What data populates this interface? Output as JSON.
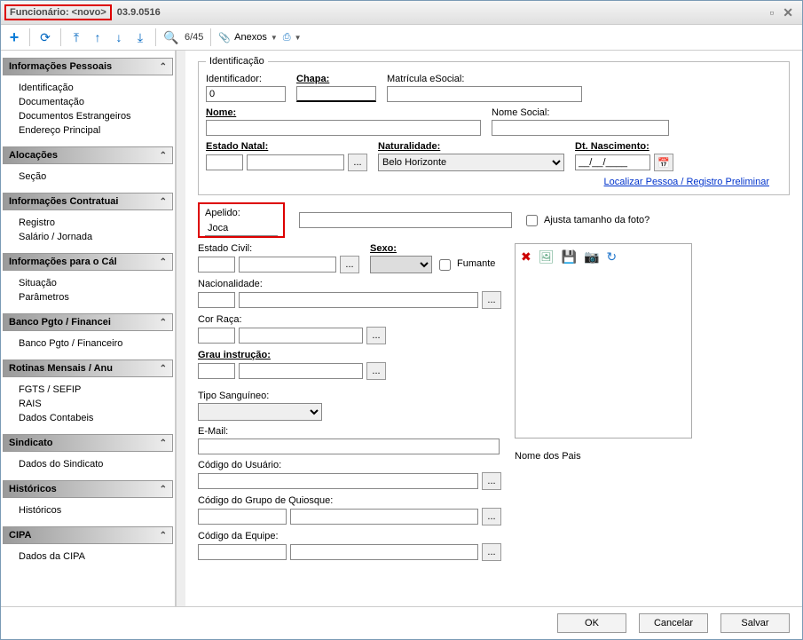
{
  "window": {
    "title_hl": "Funcionário: <novo>",
    "title_rest": "03.9.0516"
  },
  "toolbar": {
    "counter": "6/45",
    "anexos": "Anexos"
  },
  "sidebar": [
    {
      "title": "Informações Pessoais",
      "items": [
        "Identificação",
        "Documentação",
        "Documentos Estrangeiros",
        "Endereço Principal"
      ]
    },
    {
      "title": "Alocações",
      "items": [
        "Seção"
      ]
    },
    {
      "title": "Informações Contratuai",
      "items": [
        "Registro",
        "Salário / Jornada"
      ]
    },
    {
      "title": "Informações para o Cál",
      "items": [
        "Situação",
        "Parâmetros"
      ]
    },
    {
      "title": "Banco Pgto / Financei",
      "items": [
        "Banco Pgto / Financeiro"
      ]
    },
    {
      "title": "Rotinas Mensais / Anu",
      "items": [
        "FGTS / SEFIP",
        "RAIS",
        "Dados Contabeis"
      ]
    },
    {
      "title": "Sindicato",
      "items": [
        "Dados do Sindicato"
      ]
    },
    {
      "title": "Históricos",
      "items": [
        "Históricos"
      ]
    },
    {
      "title": "CIPA",
      "items": [
        "Dados da CIPA"
      ]
    }
  ],
  "form": {
    "legend": "Identificação",
    "identificador": {
      "label": "Identificador:",
      "value": "0"
    },
    "chapa": {
      "label": "Chapa:"
    },
    "matricula": {
      "label": "Matrícula eSocial:"
    },
    "nome": {
      "label": "Nome:"
    },
    "nome_social": {
      "label": "Nome Social:"
    },
    "estado_natal": {
      "label": "Estado Natal:"
    },
    "naturalidade": {
      "label": "Naturalidade:",
      "value": "Belo Horizonte"
    },
    "dt_nasc": {
      "label": "Dt. Nascimento:",
      "value": "__/__/____"
    },
    "localizar_link": "Localizar Pessoa / Registro Preliminar",
    "apelido": {
      "label": "Apelido:",
      "value": "Joca"
    },
    "ajusta_foto": "Ajusta tamanho da foto?",
    "estado_civil": {
      "label": "Estado Civil:"
    },
    "sexo": {
      "label": "Sexo:"
    },
    "fumante": "Fumante",
    "nacionalidade": {
      "label": "Nacionalidade:"
    },
    "cor_raca": {
      "label": "Cor Raça:"
    },
    "grau_instrucao": {
      "label": "Grau instrução:"
    },
    "tipo_sanguineo": {
      "label": "Tipo Sanguíneo:"
    },
    "email": {
      "label": "E-Mail:"
    },
    "cod_usuario": {
      "label": "Código do Usuário:"
    },
    "cod_grupo_quiosque": {
      "label": "Código do Grupo de Quiosque:"
    },
    "cod_equipe": {
      "label": "Código da Equipe:"
    },
    "nome_pais": "Nome dos Pais"
  },
  "footer": {
    "ok": "OK",
    "cancel": "Cancelar",
    "save": "Salvar"
  }
}
